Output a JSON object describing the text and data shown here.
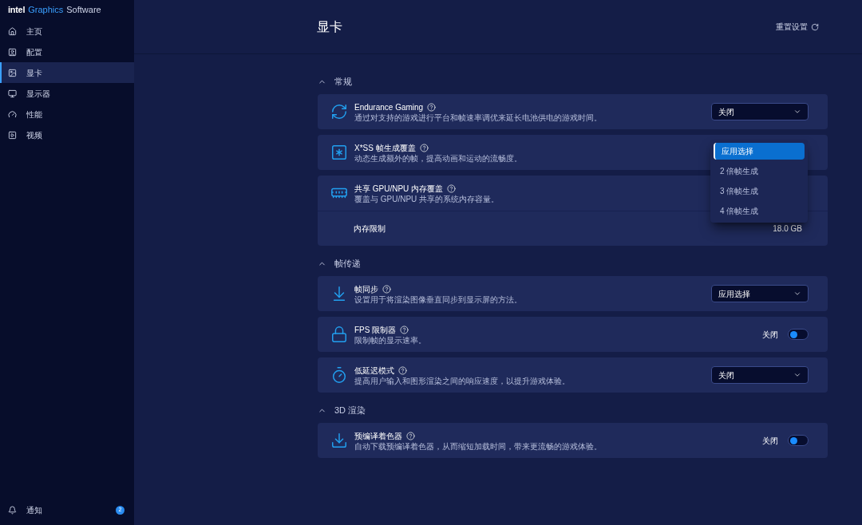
{
  "app_title": {
    "brand": "intel",
    "product": "Graphics",
    "suffix": "Software"
  },
  "sidebar": {
    "items": [
      {
        "label": "主页",
        "selected": false
      },
      {
        "label": "配置",
        "selected": false
      },
      {
        "label": "显卡",
        "selected": true
      },
      {
        "label": "显示器",
        "selected": false
      },
      {
        "label": "性能",
        "selected": false
      },
      {
        "label": "视频",
        "selected": false
      }
    ],
    "notifications": {
      "label": "通知",
      "count": "2"
    }
  },
  "page": {
    "title": "显卡",
    "reset": "重置设置"
  },
  "sections": [
    {
      "title": "常规",
      "expanded": true,
      "settings": [
        {
          "kind": "dropdown",
          "title": "Endurance Gaming",
          "description": "通过对支持的游戏进行平台和帧速率调优来延长电池供电的游戏时间。",
          "value": "关闭"
        },
        {
          "kind": "menu",
          "title": "X*SS 帧生成覆盖",
          "description": "动态生成额外的帧，提高动画和运动的流畅度。",
          "options": [
            {
              "label": "应用选择",
              "selected": true
            },
            {
              "label": "2 倍帧生成",
              "selected": false
            },
            {
              "label": "3 倍帧生成",
              "selected": false
            },
            {
              "label": "4 倍帧生成",
              "selected": false
            }
          ]
        },
        {
          "kind": "memory",
          "title": "共享 GPU/NPU 内存覆盖",
          "description": "覆盖与 GPU/NPU 共享的系统内存容量。",
          "sub_label": "内存限制",
          "sub_value": "18.0 GB"
        }
      ]
    },
    {
      "title": "帧传递",
      "expanded": true,
      "settings": [
        {
          "kind": "dropdown",
          "title": "帧同步",
          "description": "设置用于将渲染图像垂直同步到显示屏的方法。",
          "value": "应用选择"
        },
        {
          "kind": "toggle",
          "title": "FPS 限制器",
          "description": "限制帧的显示速率。",
          "state_label": "关闭",
          "on": false
        },
        {
          "kind": "dropdown",
          "title": "低延迟模式",
          "description": "提高用户输入和图形渲染之间的响应速度，以提升游戏体验。",
          "value": "关闭"
        }
      ]
    },
    {
      "title": "3D 渲染",
      "expanded": true,
      "settings": [
        {
          "kind": "toggle",
          "title": "预编译着色器",
          "description": "自动下载预编译着色器，从而缩短加载时间，带来更流畅的游戏体验。",
          "state_label": "关闭",
          "on": false
        }
      ]
    }
  ]
}
